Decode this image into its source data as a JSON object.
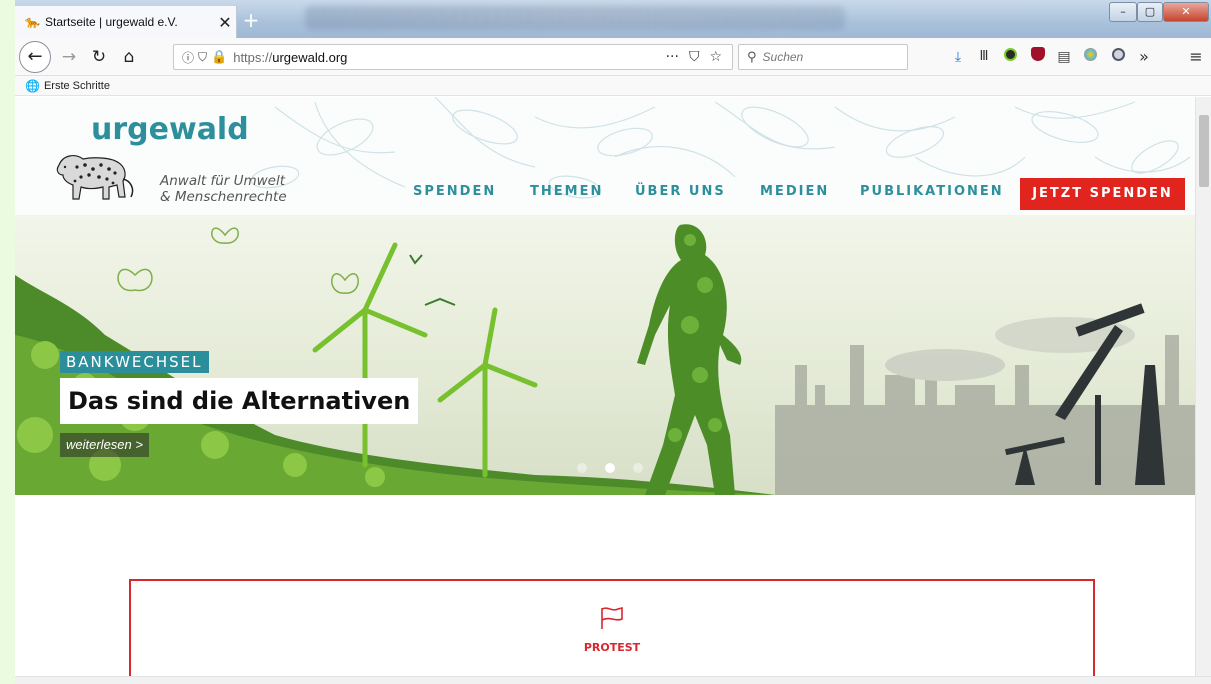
{
  "browser": {
    "tab_title": "Startseite | urgewald e.V.",
    "tab_close": "✕",
    "new_tab": "+",
    "url_scheme": "https://",
    "url_host": "urgewald.org",
    "url_menu": "···",
    "search_placeholder": "Suchen",
    "overflow": "»",
    "menu": "≡",
    "bookmark_label": "Erste Schritte",
    "window_min": "–",
    "window_max": "▢",
    "window_close": "✕"
  },
  "site": {
    "logo": "urgewald",
    "tagline_line1": "Anwalt für Umwelt",
    "tagline_line2": "& Menschenrechte",
    "nav": [
      "SPENDEN",
      "THEMEN",
      "ÜBER UNS",
      "MEDIEN",
      "PUBLIKATIONEN"
    ],
    "donate_button": "JETZT SPENDEN",
    "accent_color": "#2d8f9c",
    "donate_color": "#e1241d"
  },
  "hero": {
    "kicker": "BANKWECHSEL",
    "headline": "Das sind die Alternativen",
    "read_more": "weiterlesen >",
    "slides_total": 3,
    "active_slide": 2
  },
  "card": {
    "icon": "flag-icon",
    "label": "PROTEST"
  }
}
